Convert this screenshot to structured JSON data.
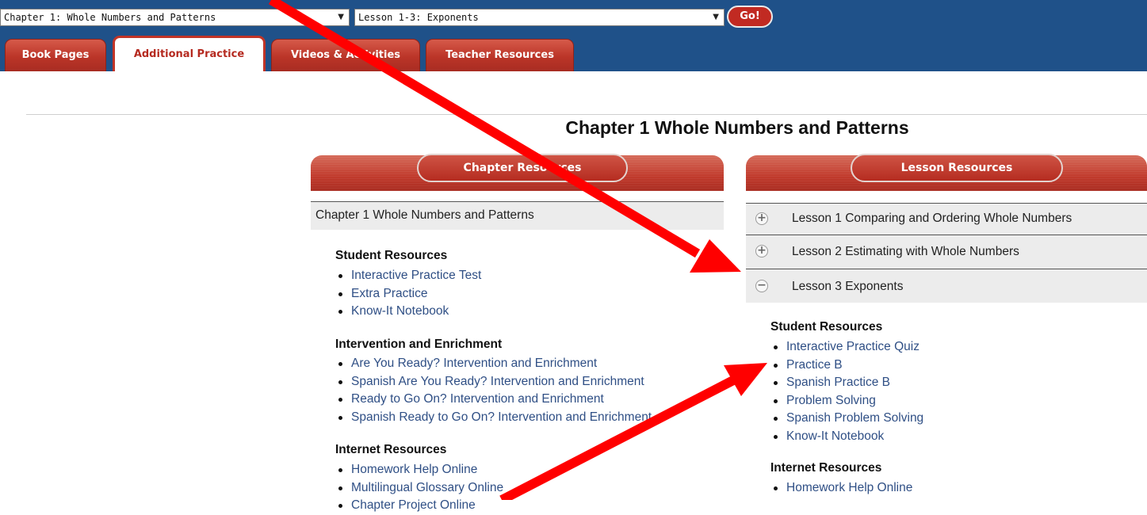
{
  "toolbar": {
    "chapter_select": "Chapter 1: Whole Numbers and Patterns",
    "lesson_select": "Lesson 1-3: Exponents",
    "go_label": "Go!"
  },
  "tabs": [
    {
      "label": "Book Pages",
      "active": false
    },
    {
      "label": "Additional Practice",
      "active": true
    },
    {
      "label": "Videos & Activities",
      "active": false
    },
    {
      "label": "Teacher Resources",
      "active": false
    }
  ],
  "page": {
    "title": "Chapter 1 Whole Numbers and Patterns"
  },
  "chapter_panel": {
    "header": "Chapter Resources",
    "row_label": "Chapter 1 Whole Numbers and Patterns",
    "sections": [
      {
        "heading": "Student Resources",
        "items": [
          "Interactive Practice Test",
          "Extra Practice",
          "Know-It Notebook"
        ]
      },
      {
        "heading": "Intervention and Enrichment",
        "items": [
          "Are You Ready? Intervention and Enrichment",
          "Spanish Are You Ready? Intervention and Enrichment",
          "Ready to Go On? Intervention and Enrichment",
          "Spanish Ready to Go On? Intervention and Enrichment"
        ]
      },
      {
        "heading": "Internet Resources",
        "items": [
          "Homework Help Online",
          "Multilingual Glossary Online",
          "Chapter Project Online"
        ]
      }
    ]
  },
  "lesson_panel": {
    "header": "Lesson Resources",
    "lessons": [
      {
        "label": "Lesson 1 Comparing and Ordering Whole Numbers",
        "toggle": "+"
      },
      {
        "label": "Lesson 2 Estimating with Whole Numbers",
        "toggle": "+"
      },
      {
        "label": "Lesson 3 Exponents",
        "toggle": "−"
      }
    ],
    "sections": [
      {
        "heading": "Student Resources",
        "items": [
          "Interactive Practice Quiz",
          "Practice B",
          "Spanish Practice B",
          "Problem Solving",
          "Spanish Problem Solving",
          "Know-It Notebook"
        ]
      },
      {
        "heading": "Internet Resources",
        "items": [
          "Homework Help Online"
        ]
      }
    ]
  },
  "colors": {
    "topbar": "#1f5189",
    "tab_red": "#bb3528",
    "link_blue": "#2f4f85",
    "annotation_red": "#ff0000"
  }
}
